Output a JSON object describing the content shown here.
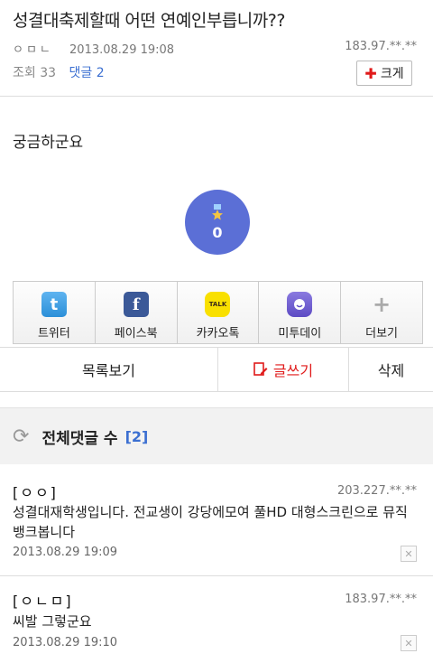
{
  "post": {
    "title": "성결대축제할때 어떤 연예인부릅니까??",
    "author": "ㅇㅁㄴ",
    "date": "2013.08.29 19:08",
    "ip": "183.97.**.**",
    "views_label": "조회 33",
    "comments_label": "댓글 2",
    "body": "궁금하군요"
  },
  "bigtext_button": {
    "label": "크게",
    "icon": "plus-icon"
  },
  "vote": {
    "count": "0",
    "icon": "medal-icon"
  },
  "share": [
    {
      "label": "트위터",
      "icon": "twitter-icon"
    },
    {
      "label": "페이스북",
      "icon": "facebook-icon"
    },
    {
      "label": "카카오톡",
      "icon": "kakaotalk-icon"
    },
    {
      "label": "미투데이",
      "icon": "me2day-icon"
    },
    {
      "label": "더보기",
      "icon": "more-plus-icon"
    }
  ],
  "actions": {
    "list": "목록보기",
    "write": "글쓰기",
    "delete": "삭제"
  },
  "comments_header": {
    "title": "전체댓글 수",
    "count": "[2]"
  },
  "comments": [
    {
      "author": "[ㅇㅇ]",
      "ip": "203.227.**.**",
      "text": "성결대재학생입니다. 전교생이 강당에모여 풀HD 대형스크린으로 뮤직뱅크봅니다",
      "date": "2013.08.29 19:09"
    },
    {
      "author": "[ㅇㄴㅁ]",
      "ip": "183.97.**.**",
      "text": "씨발 그렇군요",
      "date": "2013.08.29 19:10"
    }
  ],
  "colors": {
    "accent_blue": "#3b6fd1",
    "vote_bg": "#5b6fd6",
    "write_red": "#e01a1a"
  }
}
